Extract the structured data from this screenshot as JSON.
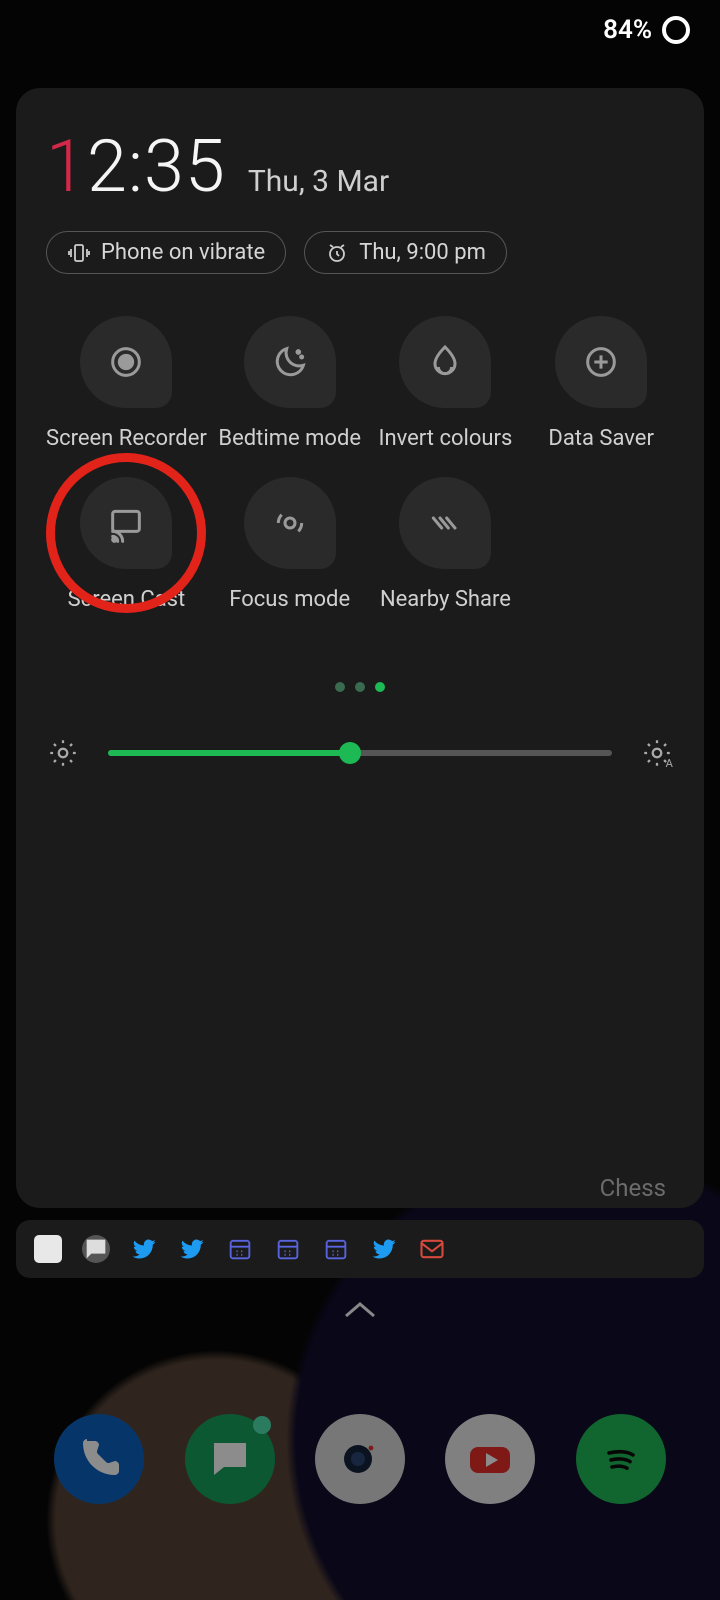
{
  "status": {
    "battery_pct": "84%"
  },
  "clock": {
    "accent_digit": "1",
    "rest": "2:35",
    "date": "Thu, 3 Mar"
  },
  "chips": {
    "vibrate_label": "Phone on vibrate",
    "alarm_label": "Thu, 9:00 pm"
  },
  "tiles": [
    {
      "id": "screen-recorder",
      "label": "Screen Recorder",
      "icon": "record-icon",
      "highlighted": false
    },
    {
      "id": "bedtime-mode",
      "label": "Bedtime mode",
      "icon": "moon-icon",
      "highlighted": false
    },
    {
      "id": "invert-colours",
      "label": "Invert colours",
      "icon": "invert-icon",
      "highlighted": false
    },
    {
      "id": "data-saver",
      "label": "Data Saver",
      "icon": "data-saver-icon",
      "highlighted": false
    },
    {
      "id": "screen-cast",
      "label": "Screen Cast",
      "icon": "cast-icon",
      "highlighted": true
    },
    {
      "id": "focus-mode",
      "label": "Focus mode",
      "icon": "focus-icon",
      "highlighted": false
    },
    {
      "id": "nearby-share",
      "label": "Nearby Share",
      "icon": "nearby-icon",
      "highlighted": false
    }
  ],
  "pager": {
    "count": 3,
    "active": 2
  },
  "brightness": {
    "percent": 48
  },
  "background_hint": "Chess",
  "notif_icons": [
    "square",
    "chat",
    "twitter",
    "twitter",
    "calendar",
    "calendar",
    "calendar",
    "twitter",
    "gmail"
  ],
  "dock": [
    "phone",
    "chat",
    "camera",
    "youtube",
    "spotify"
  ],
  "colors": {
    "accent_green": "#1db954",
    "accent_red": "#d4284b",
    "panel_bg": "#1b1b1b",
    "highlight_ring": "#e2231a"
  }
}
